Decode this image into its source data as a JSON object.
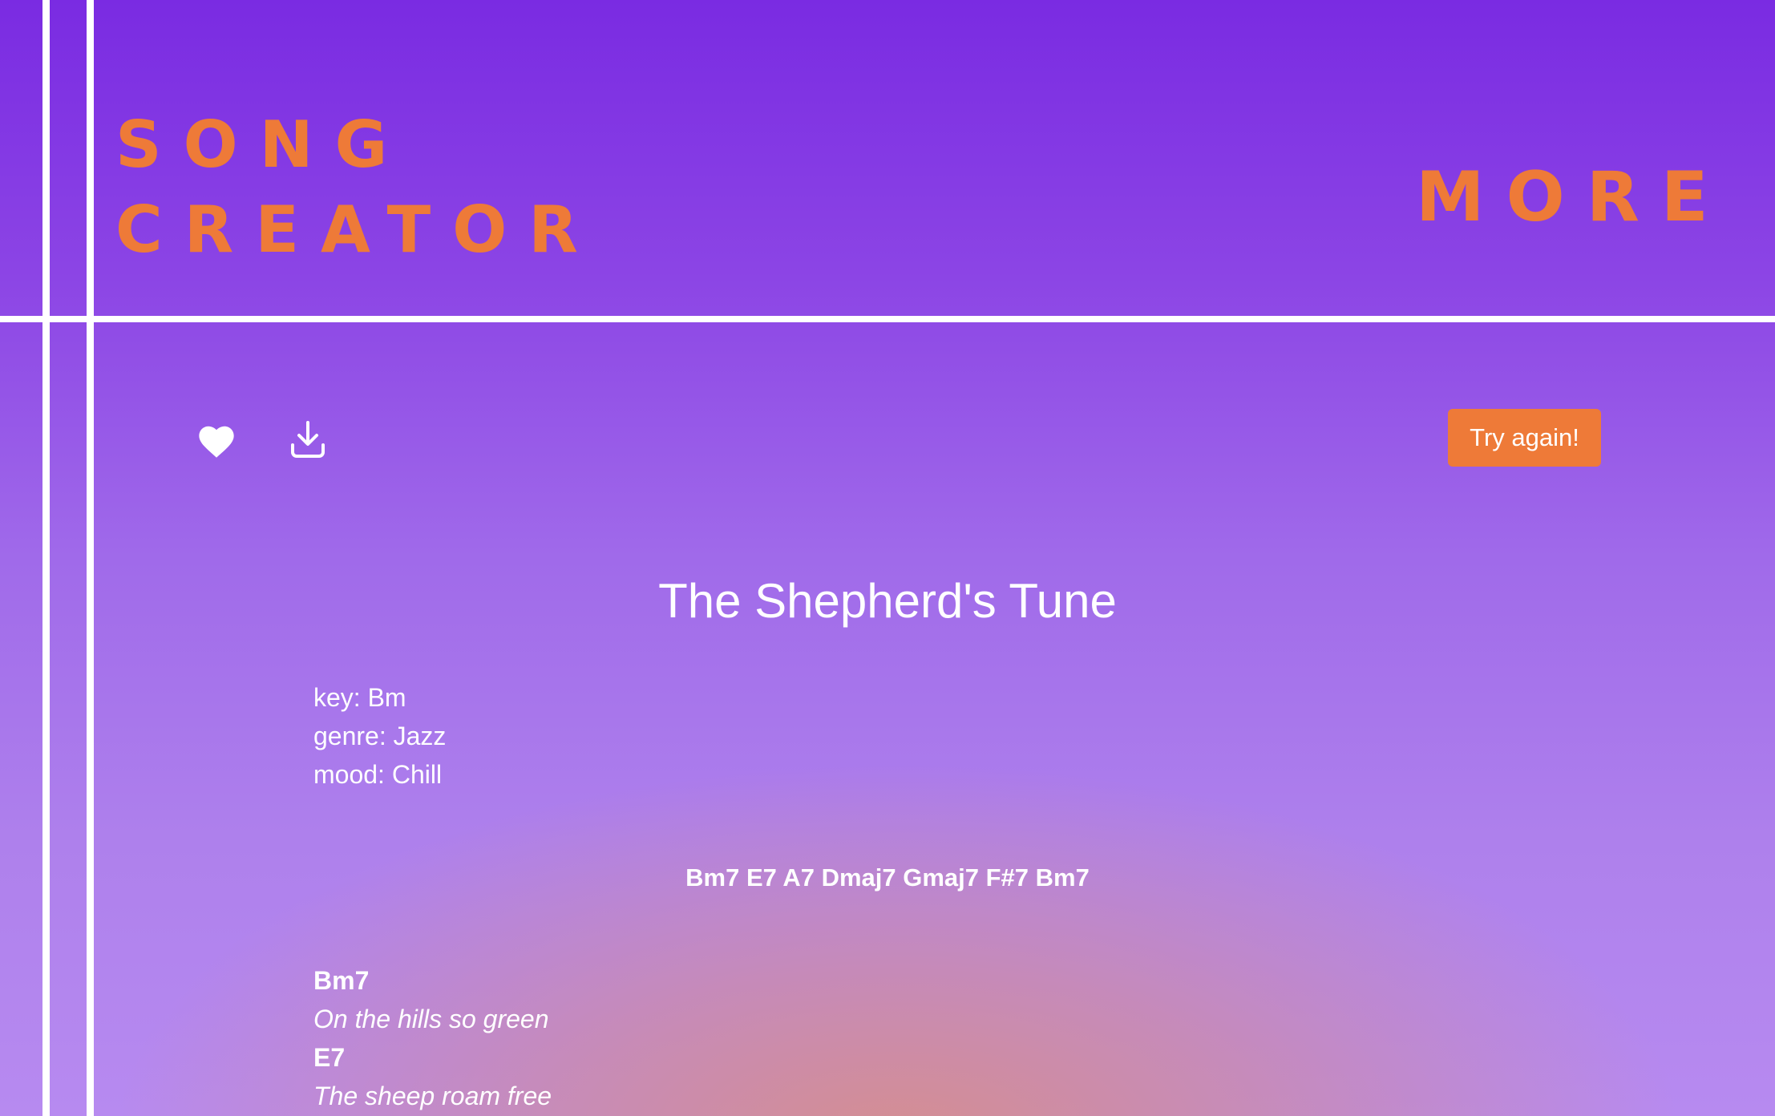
{
  "header": {
    "brand_line1": "SONG",
    "brand_line2": "CREATOR",
    "nav_more": "MORE"
  },
  "actions": {
    "favorite_icon": "heart-icon",
    "download_icon": "download-icon",
    "try_again_label": "Try again!"
  },
  "song": {
    "title": "The Shepherd's Tune",
    "key": "key: Bm",
    "genre": "genre: Jazz",
    "mood": "mood: Chill",
    "progression": "Bm7 E7 A7 Dmaj7 Gmaj7 F#7 Bm7",
    "lines": [
      {
        "chord": "Bm7",
        "lyric": "On the hills so green"
      },
      {
        "chord": "E7",
        "lyric": "The sheep roam free"
      }
    ]
  },
  "colors": {
    "accent": "#ee7a38",
    "background_top": "#7a2be2",
    "background_bottom": "#b78af0",
    "text": "#ffffff"
  }
}
